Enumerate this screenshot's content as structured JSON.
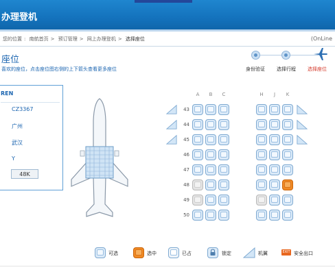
{
  "header": {
    "title": "办理登机"
  },
  "breadcrumb": {
    "items": [
      "您的位置",
      "南航首页",
      "预订管理",
      "网上办理登机",
      "选择座位"
    ],
    "separator": ">",
    "online_tag": "(OnLine"
  },
  "page": {
    "title": "座位",
    "subtitle": "喜欢的座位，点击座位图右侧的上下箭头查看更多座位"
  },
  "steps": [
    {
      "label": "身份验证",
      "state": "done"
    },
    {
      "label": "选择行程",
      "state": "done"
    },
    {
      "label": "选择座位",
      "state": "active"
    }
  ],
  "flight": {
    "passenger": "REN",
    "flight_no": "CZ3367",
    "origin": "广州",
    "destination": "武汉",
    "cabin": "Y",
    "seat": "48K"
  },
  "seat_map": {
    "columns_left": [
      "A",
      "B",
      "C"
    ],
    "columns_right": [
      "H",
      "J",
      "K"
    ],
    "rows": [
      {
        "num": "43",
        "wing": true,
        "seats": [
          "free",
          "free",
          "free",
          "free",
          "free",
          "free"
        ]
      },
      {
        "num": "44",
        "wing": true,
        "seats": [
          "free",
          "free",
          "free",
          "free",
          "free",
          "free"
        ]
      },
      {
        "num": "45",
        "wing": true,
        "seats": [
          "free",
          "free",
          "free",
          "free",
          "free",
          "free"
        ]
      },
      {
        "num": "46",
        "wing": false,
        "seats": [
          "free",
          "free",
          "free",
          "free",
          "free",
          "free"
        ]
      },
      {
        "num": "47",
        "wing": false,
        "seats": [
          "free",
          "free",
          "free",
          "free",
          "free",
          "free"
        ]
      },
      {
        "num": "48",
        "wing": false,
        "seats": [
          "taken",
          "free",
          "free",
          "free",
          "free",
          "selected"
        ]
      },
      {
        "num": "49",
        "wing": false,
        "seats": [
          "taken",
          "free",
          "free",
          "taken",
          "free",
          "free"
        ]
      },
      {
        "num": "50",
        "wing": false,
        "seats": [
          "free",
          "free",
          "free",
          "free",
          "free",
          "free"
        ]
      }
    ]
  },
  "legend": {
    "available": "可选",
    "selected": "选中",
    "occupied": "已占",
    "locked": "锁定",
    "wing": "机翼",
    "exit_badge": "EXIT",
    "exit": "安全出口"
  },
  "colors": {
    "brand_blue": "#1473bd",
    "link_blue": "#1a64b0",
    "selected_orange": "#f08a24",
    "active_step_red": "#d43a2b"
  }
}
